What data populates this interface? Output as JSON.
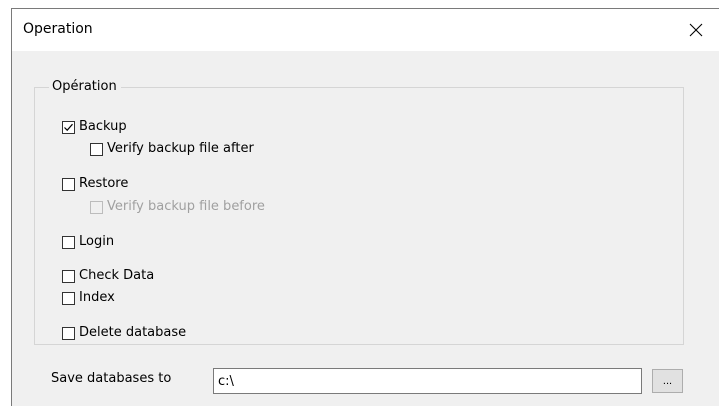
{
  "window": {
    "title": "Operation"
  },
  "group": {
    "legend": "Opération"
  },
  "options": {
    "backup": {
      "label": "Backup",
      "checked": true,
      "enabled": true
    },
    "verify_after": {
      "label": "Verify backup file after",
      "checked": false,
      "enabled": true
    },
    "restore": {
      "label": "Restore",
      "checked": false,
      "enabled": true
    },
    "verify_before": {
      "label": "Verify backup file before",
      "checked": false,
      "enabled": false
    },
    "login": {
      "label": "Login",
      "checked": false,
      "enabled": true
    },
    "check_data": {
      "label": "Check Data",
      "checked": false,
      "enabled": true
    },
    "index": {
      "label": "Index",
      "checked": false,
      "enabled": true
    },
    "delete_db": {
      "label": "Delete database",
      "checked": false,
      "enabled": true
    }
  },
  "save": {
    "label": "Save databases to",
    "path": "c:\\",
    "browse_label": "..."
  },
  "icons": {
    "close": "close-icon",
    "check": "checkmark-icon"
  }
}
